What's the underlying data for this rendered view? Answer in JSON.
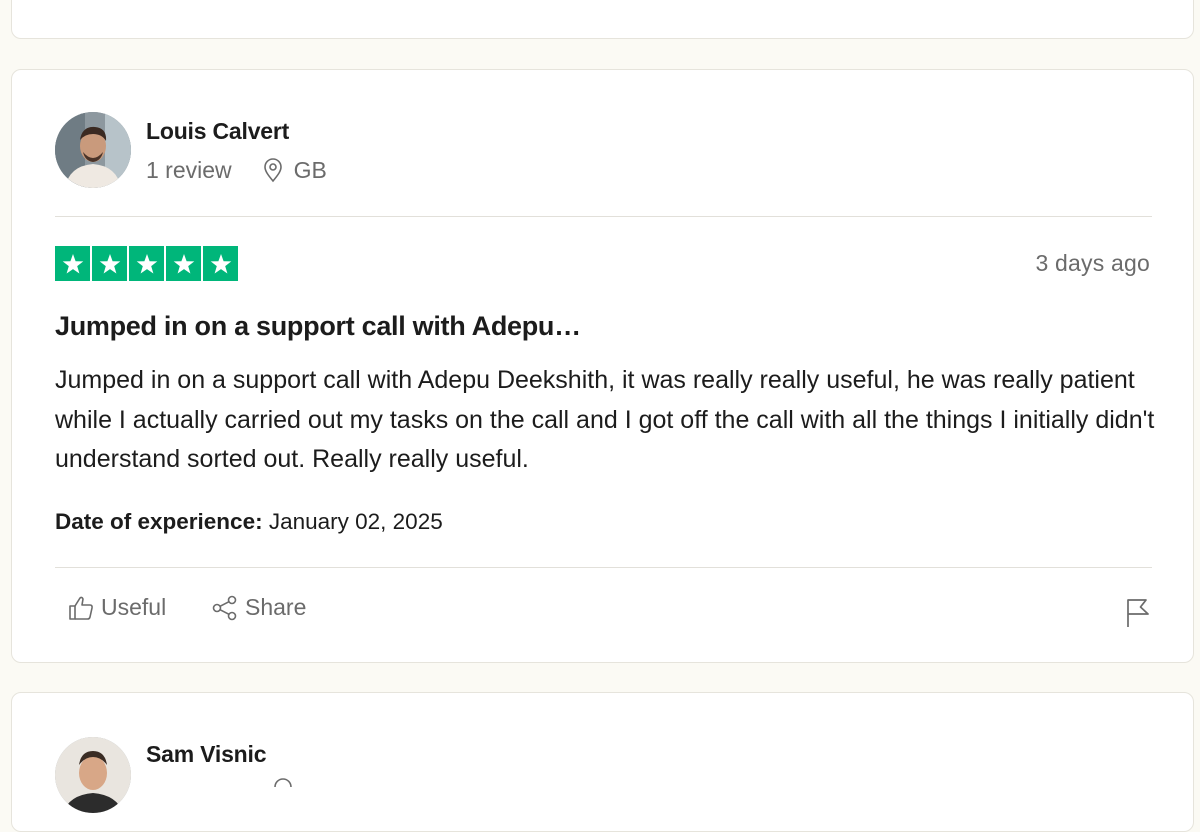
{
  "review": {
    "reviewer": {
      "name": "Louis Calvert",
      "review_count": "1 review",
      "country": "GB"
    },
    "rating": 5,
    "rating_color": "#00b67a",
    "posted_ago": "3 days ago",
    "title": "Jumped in on a support call with Adepu…",
    "body": "Jumped in on a support call with Adepu Deekshith, it was really really useful, he was really patient while I actually carried out my tasks on the call and I got off the call with all the things I initially didn't understand sorted out. Really really useful.",
    "experience_label": "Date of experience:",
    "experience_date": "January 02, 2025",
    "actions": {
      "useful": "Useful",
      "share": "Share"
    }
  },
  "next_review": {
    "reviewer": {
      "name": "Sam Visnic"
    }
  }
}
